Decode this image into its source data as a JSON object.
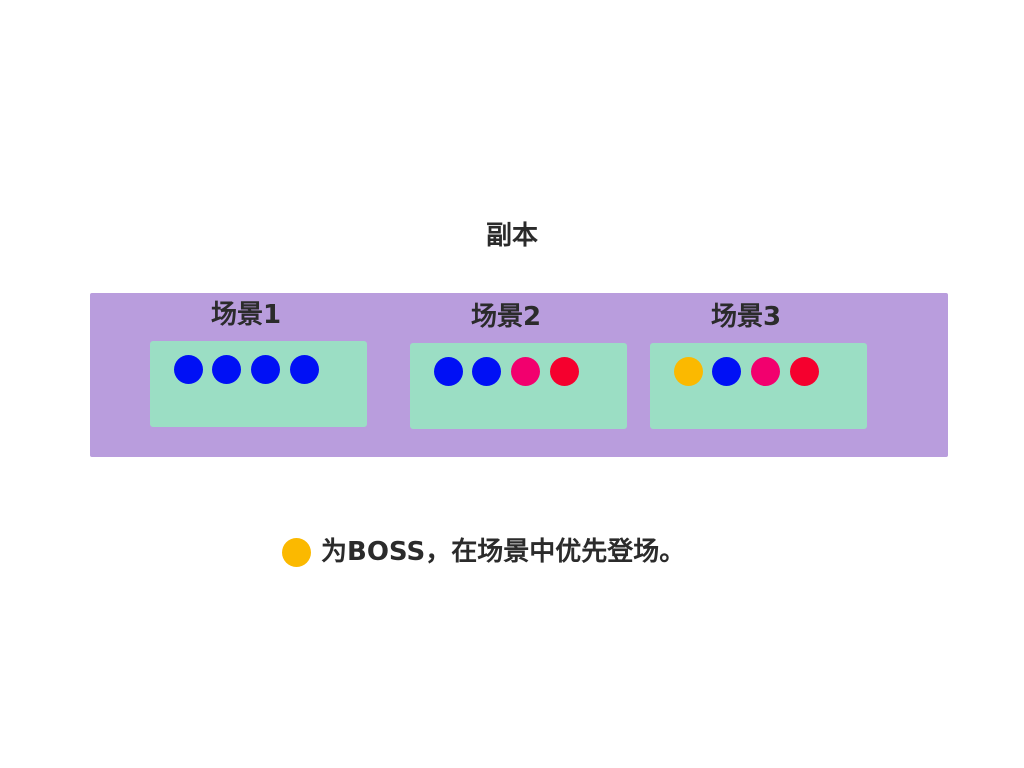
{
  "title": "副本",
  "colors": {
    "dungeon_bg": "#b99ddd",
    "scene_bg": "#9bdec4",
    "blue": "#0010f5",
    "pink": "#f2006e",
    "red": "#f5002e",
    "boss": "#fbb900"
  },
  "scenes": [
    {
      "label": "场景1",
      "dots": [
        "blue",
        "blue",
        "blue",
        "blue"
      ]
    },
    {
      "label": "场景2",
      "dots": [
        "blue",
        "blue",
        "pink",
        "red"
      ]
    },
    {
      "label": "场景3",
      "dots": [
        "boss",
        "blue",
        "pink",
        "red"
      ]
    }
  ],
  "legend": {
    "dot": "boss",
    "text": "为BOSS，在场景中优先登场。"
  }
}
